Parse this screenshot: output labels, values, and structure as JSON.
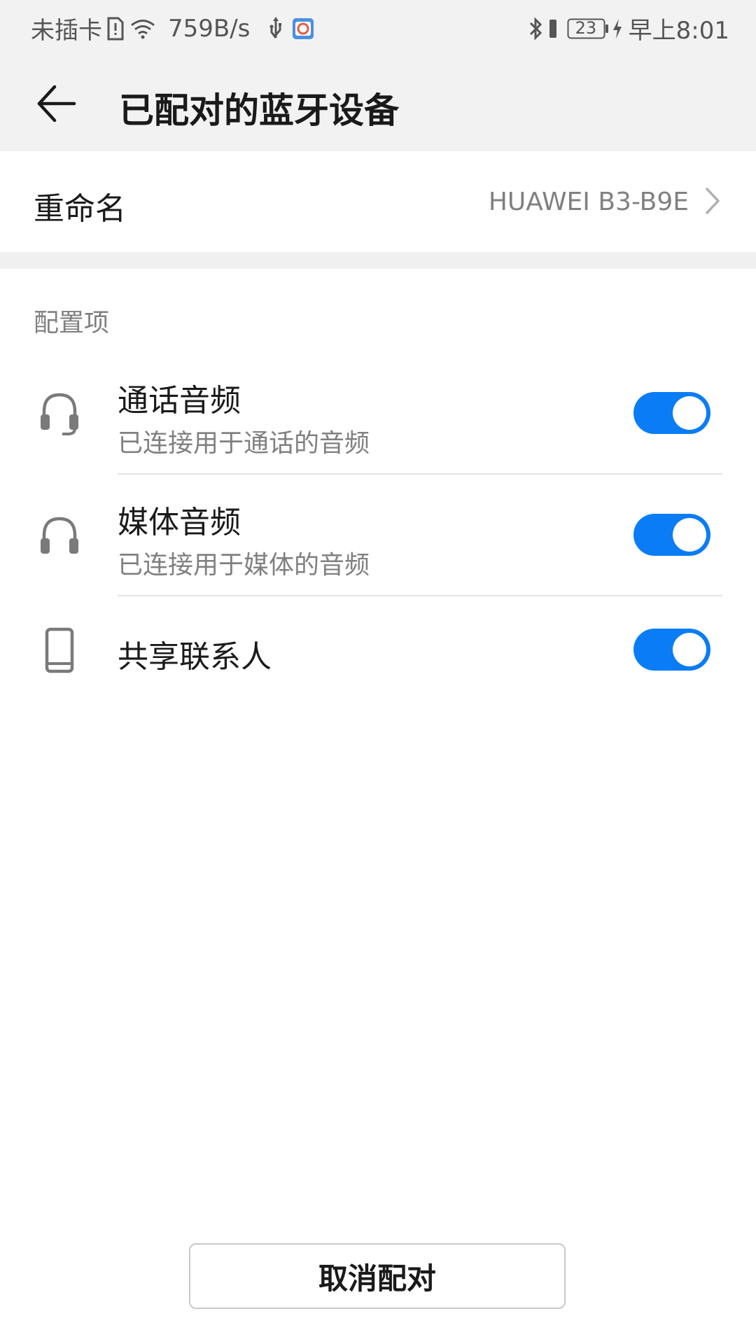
{
  "status_bar": {
    "carrier": "未插卡",
    "network_speed": "759B/s",
    "battery_level": "23",
    "time": "早上8:01",
    "icons": [
      "sim-alert-icon",
      "wifi-icon",
      "usb-icon",
      "app-notification-icon",
      "bluetooth-icon",
      "vibrate-icon",
      "battery-icon",
      "charging-icon"
    ]
  },
  "app_bar": {
    "title": "已配对的蓝牙设备",
    "back_icon": "arrow-left-icon"
  },
  "rename": {
    "label": "重命名",
    "value": "HUAWEI B3-B9E",
    "chevron_icon": "chevron-right-icon"
  },
  "config_section": {
    "header": "配置项",
    "items": [
      {
        "icon": "headset-icon",
        "title": "通话音频",
        "subtitle": "已连接用于通话的音频",
        "enabled": true
      },
      {
        "icon": "headphones-icon",
        "title": "媒体音频",
        "subtitle": "已连接用于媒体的音频",
        "enabled": true
      },
      {
        "icon": "phone-icon",
        "title": "共享联系人",
        "subtitle": "",
        "enabled": true
      }
    ]
  },
  "unpair_button": {
    "label": "取消配对"
  },
  "colors": {
    "accent": "#0a7cf6",
    "header_bg": "#f2f2f2",
    "secondary_text": "#808080"
  }
}
